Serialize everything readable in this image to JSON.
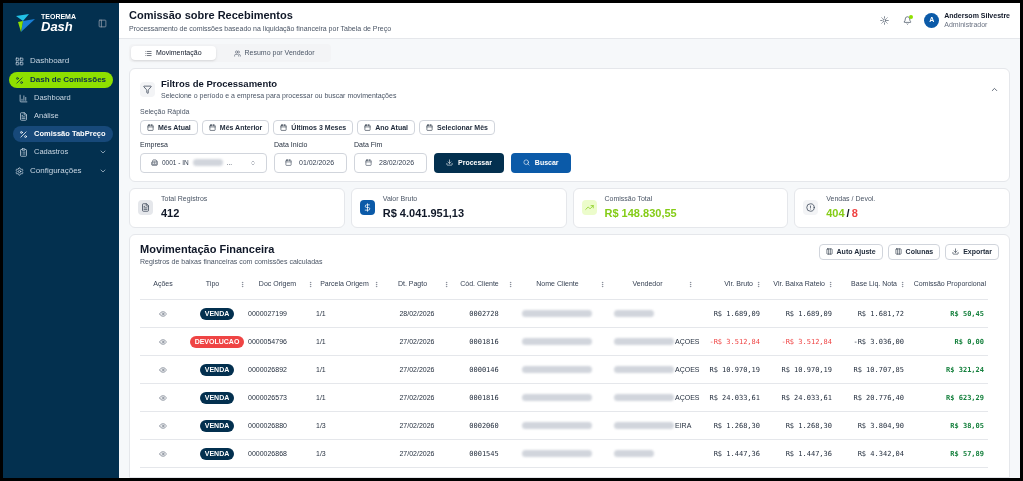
{
  "brand": {
    "top": "TEOREMA",
    "name": "Dash"
  },
  "sidebar": {
    "items": [
      {
        "label": "Dashboard",
        "selected": false
      },
      {
        "label": "Dash de Comissões",
        "selected": true,
        "expanded": true,
        "children": [
          {
            "label": "Dashboard",
            "selected": false
          },
          {
            "label": "Análise",
            "selected": false
          },
          {
            "label": "Comissão TabPreço",
            "selected": true
          },
          {
            "label": "Cadastros",
            "selected": false,
            "expanded": false
          }
        ]
      },
      {
        "label": "Configurações",
        "selected": false,
        "expanded": false
      }
    ]
  },
  "header": {
    "title": "Comissão sobre Recebimentos",
    "subtitle": "Processamento de comissões baseado na liquidação financeira por Tabela de Preço",
    "notification": true,
    "user": {
      "initial": "A",
      "name": "Andersom Silvestre",
      "role": "Administrador"
    }
  },
  "tabs": [
    {
      "label": "Movimentação",
      "selected": true
    },
    {
      "label": "Resumo por Vendedor",
      "selected": false
    }
  ],
  "filters": {
    "title": "Filtros de Processamento",
    "subtitle": "Selecione o período e a empresa para processar ou buscar movimentações",
    "expanded": true,
    "quick_label": "Seleção Rápida",
    "quick": [
      "Mês Atual",
      "Mês Anterior",
      "Últimos 3 Meses",
      "Ano Atual",
      "Selecionar Mês"
    ],
    "empresa": {
      "label": "Empresa",
      "value_start": "0001 - IN",
      "value_end": "..."
    },
    "data_inicio": {
      "label": "Data Início",
      "value": "01/02/2026"
    },
    "data_fim": {
      "label": "Data Fim",
      "value": "28/02/2026"
    },
    "buttons": [
      {
        "label": "Processar",
        "kind": "primary"
      },
      {
        "label": "Buscar",
        "kind": "secondary"
      }
    ]
  },
  "stats": [
    {
      "kind": "file",
      "label": "Total Registros",
      "value": "412"
    },
    {
      "kind": "money",
      "label": "Valor Bruto",
      "value": "R$ 4.041.951,13"
    },
    {
      "kind": "trend",
      "label": "Comissão Total",
      "value": "R$ 148.830,55"
    },
    {
      "kind": "ratio",
      "label": "Vendas / Devol.",
      "sales": "404",
      "separator": "/",
      "returns": "8"
    }
  ],
  "table": {
    "title": "Movimentação Financeira",
    "subtitle": "Registros de baixas financeiras com comissões calculadas",
    "actions": [
      "Auto Ajuste",
      "Colunas",
      "Exportar"
    ],
    "columns": [
      {
        "label": "Ações",
        "menu": false
      },
      {
        "label": "Tipo",
        "menu": true
      },
      {
        "label": "Doc Origem",
        "menu": true
      },
      {
        "label": "Parcela Origem",
        "menu": true
      },
      {
        "label": "Dt. Pagto",
        "menu": true
      },
      {
        "label": "Cód. Cliente",
        "menu": true
      },
      {
        "label": "Nome Cliente",
        "menu": true
      },
      {
        "label": "Vendedor",
        "menu": true
      },
      {
        "label": "Vlr. Bruto",
        "menu": true
      },
      {
        "label": "Vlr. Baixa Rateio",
        "menu": true
      },
      {
        "label": "Base Liq. Nota",
        "menu": true
      },
      {
        "label": "Comissão Proporcional",
        "menu": false
      }
    ],
    "rows": [
      {
        "kind": "venda",
        "tipo": "VENDA",
        "doc": "0000027199",
        "parcela": "1/1",
        "data": "28/02/2026",
        "cliente": "0002728",
        "vendedor_end": "",
        "bruto": "R$ 1.689,09",
        "rateio": "R$ 1.689,09",
        "base": "R$ 1.681,72",
        "comissao": "R$ 50,45"
      },
      {
        "kind": "devolucao",
        "tipo": "DEVOLUCAO",
        "doc": "0000054796",
        "parcela": "1/1",
        "data": "27/02/2026",
        "cliente": "0001816",
        "vendedor_end": "AÇOES",
        "bruto": "-R$ 3.512,84",
        "rateio": "-R$ 3.512,84",
        "base": "-R$ 3.036,00",
        "comissao": "R$ 0,00"
      },
      {
        "kind": "venda",
        "tipo": "VENDA",
        "doc": "0000026892",
        "parcela": "1/1",
        "data": "27/02/2026",
        "cliente": "0000146",
        "vendedor_end": "AÇOES",
        "bruto": "R$ 10.970,19",
        "rateio": "R$ 10.970,19",
        "base": "R$ 10.707,85",
        "comissao": "R$ 321,24"
      },
      {
        "kind": "venda",
        "tipo": "VENDA",
        "doc": "0000026573",
        "parcela": "1/1",
        "data": "27/02/2026",
        "cliente": "0001816",
        "vendedor_end": "AÇOES",
        "bruto": "R$ 24.033,61",
        "rateio": "R$ 24.033,61",
        "base": "R$ 20.776,40",
        "comissao": "R$ 623,29"
      },
      {
        "kind": "venda",
        "tipo": "VENDA",
        "doc": "0000026880",
        "parcela": "1/3",
        "data": "27/02/2026",
        "cliente": "0002060",
        "vendedor_end": "EIRA",
        "bruto": "R$ 1.268,30",
        "rateio": "R$ 1.268,30",
        "base": "R$ 3.804,90",
        "comissao": "R$ 38,05"
      },
      {
        "kind": "venda",
        "tipo": "VENDA",
        "doc": "0000026868",
        "parcela": "1/3",
        "data": "27/02/2026",
        "cliente": "0001545",
        "vendedor_end": "",
        "bruto": "R$ 1.447,36",
        "rateio": "R$ 1.447,36",
        "base": "R$ 4.342,04",
        "comissao": "R$ 57,89"
      }
    ]
  }
}
